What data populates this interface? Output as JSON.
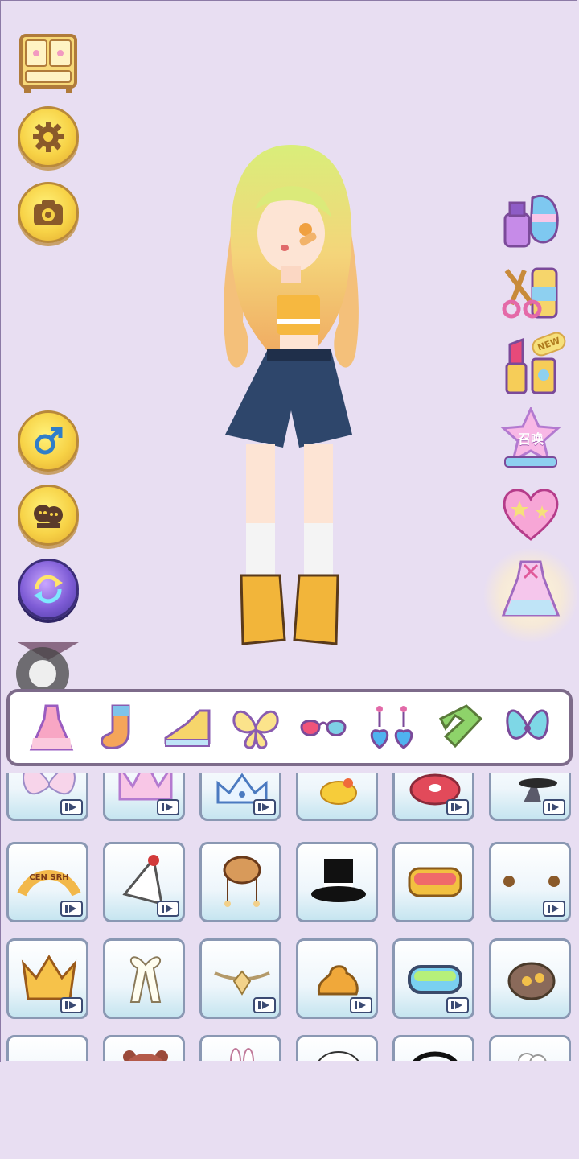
{
  "left_toolbar": {
    "wardrobe_icon": "wardrobe-icon",
    "settings_icon": "gear-icon",
    "camera_icon": "camera-icon",
    "gender_icon": "male-icon",
    "faces_icon": "faces-icon",
    "swap_icon": "swap-icon"
  },
  "right_toolbar": {
    "nail_icon": "nail-polish-icon",
    "hair_icon": "scissors-icon",
    "makeup_icon": "lipstick-icon",
    "makeup_badge": "NEW",
    "summon_label": "召唤",
    "favorite_icon": "heart-icon",
    "outfit_icon": "dress-icon"
  },
  "categories": [
    {
      "name": "dress-tab",
      "icon": "dress-icon",
      "selected": true
    },
    {
      "name": "socks-tab",
      "icon": "sock-icon",
      "selected": false
    },
    {
      "name": "shoes-tab",
      "icon": "sneaker-icon",
      "selected": false
    },
    {
      "name": "wings-tab",
      "icon": "wings-icon",
      "selected": false
    },
    {
      "name": "glasses-tab",
      "icon": "glasses-icon",
      "selected": false
    },
    {
      "name": "earrings-tab",
      "icon": "earrings-icon",
      "selected": false
    },
    {
      "name": "scarf-tab",
      "icon": "scarf-icon",
      "selected": false
    },
    {
      "name": "bow-tab",
      "icon": "bow-icon",
      "selected": false
    }
  ],
  "items": [
    {
      "icon": "bow-icon",
      "ad": true
    },
    {
      "icon": "crown-pink-icon",
      "ad": true
    },
    {
      "icon": "tiara-icon",
      "ad": true
    },
    {
      "icon": "duck-icon",
      "ad": false
    },
    {
      "icon": "donut-icon",
      "ad": true
    },
    {
      "icon": "witch-hat-icon",
      "ad": true
    },
    {
      "icon": "headband-cen-srh-icon",
      "ad": true,
      "text": "CEN SRH"
    },
    {
      "icon": "party-hat-icon",
      "ad": true
    },
    {
      "icon": "dog-hat-icon",
      "ad": false
    },
    {
      "icon": "top-hat-icon",
      "ad": false
    },
    {
      "icon": "goggles-icon",
      "ad": false
    },
    {
      "icon": "bear-ears-icon",
      "ad": true
    },
    {
      "icon": "gold-crown-icon",
      "ad": true
    },
    {
      "icon": "ribbon-icon",
      "ad": false
    },
    {
      "icon": "gem-headpiece-icon",
      "ad": true
    },
    {
      "icon": "poop-hat-icon",
      "ad": true
    },
    {
      "icon": "ski-goggles-icon",
      "ad": true
    },
    {
      "icon": "steampunk-hat-icon",
      "ad": false
    },
    {
      "icon": "partial-item-icon",
      "ad": false
    },
    {
      "icon": "bear-hat-icon",
      "ad": false
    },
    {
      "icon": "bunny-ears-icon",
      "ad": false
    },
    {
      "icon": "panda-hat-icon",
      "ad": false
    },
    {
      "icon": "headphones-icon",
      "ad": false
    },
    {
      "icon": "flower-icon",
      "ad": false
    }
  ],
  "colors": {
    "background": "#e8def2",
    "button_gold": "#f7d246",
    "tab_border": "#7d6b8a",
    "cell_bg": "#c6e5f0"
  }
}
